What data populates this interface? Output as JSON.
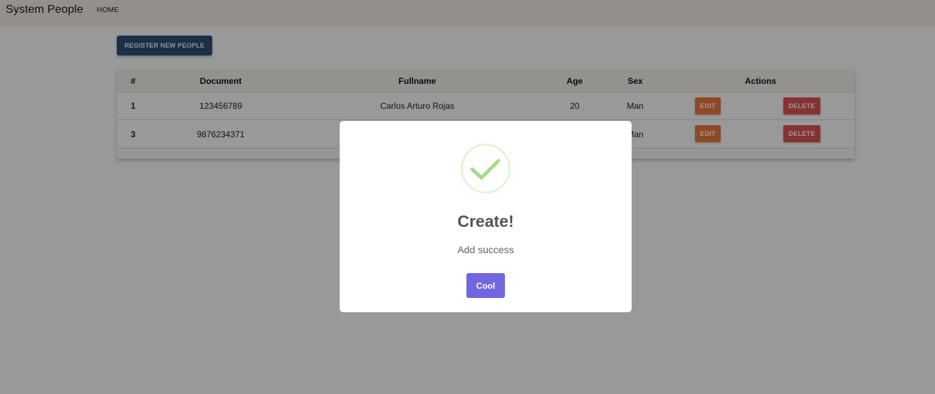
{
  "navbar": {
    "brand": "System People",
    "links": [
      "HOME"
    ]
  },
  "toolbar": {
    "register_label": "REGISTER NEW PEOPLE"
  },
  "table": {
    "headers": [
      "#",
      "Document",
      "Fullname",
      "Age",
      "Sex",
      "Actions"
    ],
    "rows": [
      {
        "id": "1",
        "document": "123456789",
        "fullname": "Carlos Arturo Rojas",
        "age": "20",
        "sex": "Man",
        "edit_label": "EDIT",
        "delete_label": "DELETE"
      },
      {
        "id": "3",
        "document": "9876234371",
        "fullname": "",
        "age": "",
        "sex": "Man",
        "edit_label": "EDIT",
        "delete_label": "DELETE"
      }
    ]
  },
  "modal": {
    "icon": "success-check-icon",
    "title": "Create!",
    "text": "Add success",
    "confirm_label": "Cool"
  },
  "colors": {
    "navbar_bg": "#f5f1ea",
    "register_button": "#2d4f78",
    "edit_button": "#ef7b3d",
    "delete_button": "#e25454",
    "confirm_button": "#7066e0",
    "success": "#a5dc86"
  }
}
